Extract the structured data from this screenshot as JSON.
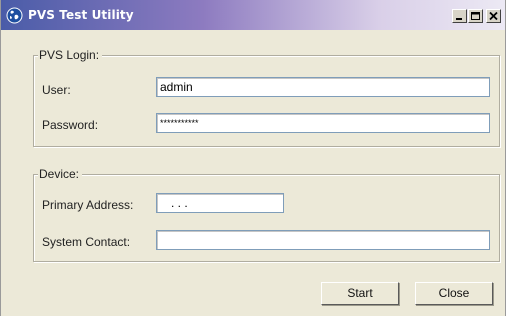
{
  "window": {
    "title": "PVS Test Utility",
    "controls": {
      "minimize_icon": "minimize-icon",
      "maximize_icon": "maximize-icon",
      "close_icon": "close-icon"
    }
  },
  "login_group": {
    "legend": "PVS Login:",
    "user": {
      "label": "User:",
      "value": "admin"
    },
    "password": {
      "label": "Password:",
      "value": "***********"
    }
  },
  "device_group": {
    "legend": "Device:",
    "primary_address": {
      "label": "Primary Address:",
      "value": ". . ."
    },
    "system_contact": {
      "label": "System Contact:",
      "value": ""
    }
  },
  "buttons": {
    "start": "Start",
    "close": "Close"
  },
  "colors": {
    "title_gradient_start": "#4a5ca8",
    "title_gradient_end": "#ece9f4",
    "window_bg": "#ece9d8",
    "field_border": "#7f9db9"
  }
}
